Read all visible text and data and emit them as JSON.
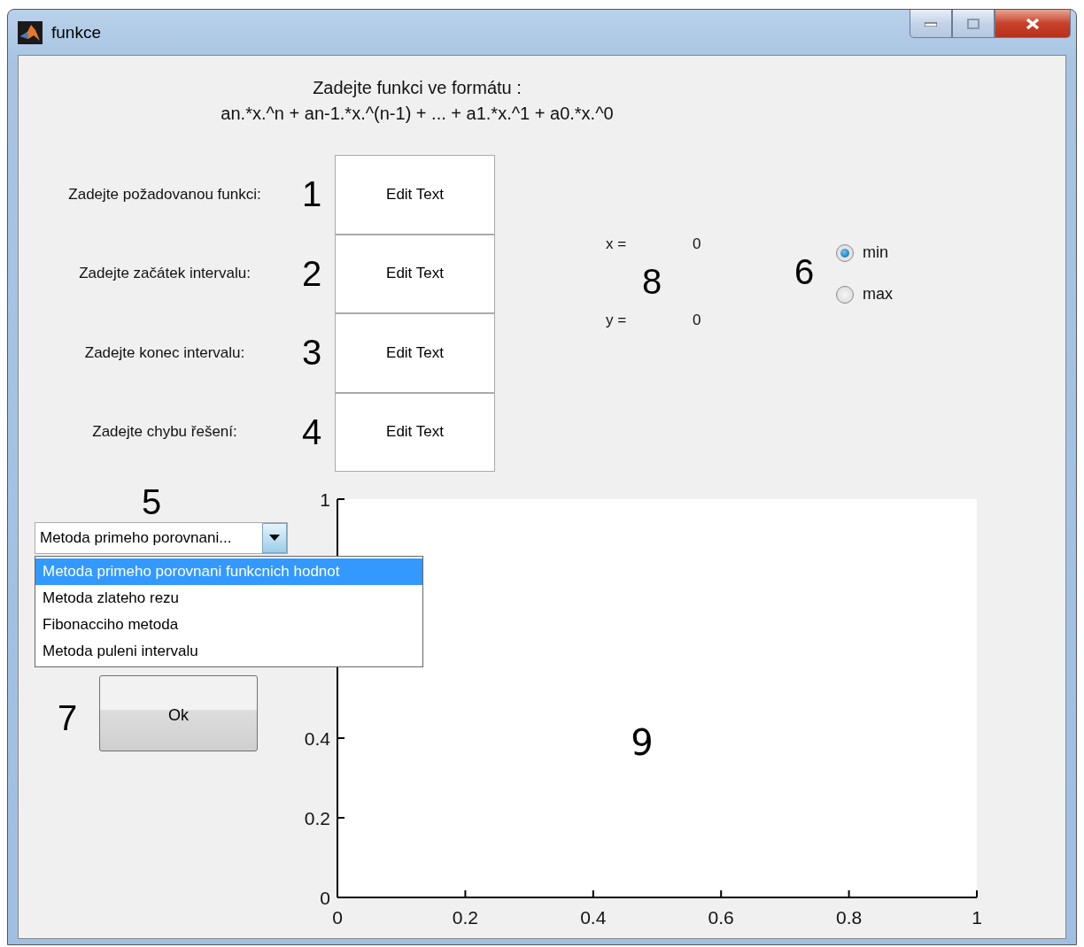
{
  "window": {
    "title": "funkce"
  },
  "heading": [
    "Zadejte funkci ve formátu :",
    "an.*x.^n + an-1.*x.^(n-1) + ... + a1.*x.^1 + a0.*x.^0"
  ],
  "inputs": [
    {
      "label": "Zadejte požadovanou funkci:",
      "number": "1",
      "value": "Edit Text"
    },
    {
      "label": "Zadejte začátek intervalu:",
      "number": "2",
      "value": "Edit Text"
    },
    {
      "label": "Zadejte konec intervalu:",
      "number": "3",
      "value": "Edit Text"
    },
    {
      "label": "Zadejte chybu řešení:",
      "number": "4",
      "value": "Edit Text"
    }
  ],
  "result": {
    "number": "8",
    "rows": [
      {
        "label": "x =",
        "value": "0"
      },
      {
        "label": "y =",
        "value": "0"
      }
    ]
  },
  "extremum": {
    "number": "6",
    "options": [
      {
        "label": "min",
        "selected": true
      },
      {
        "label": "max",
        "selected": false
      }
    ]
  },
  "method": {
    "number": "5",
    "value": "Metoda primeho porovnani...",
    "expanded": true,
    "options": [
      {
        "label": "Metoda primeho porovnani funkcnich hodnot",
        "selected": true
      },
      {
        "label": "Metoda zlateho rezu",
        "selected": false
      },
      {
        "label": "Fibonacciho metoda",
        "selected": false
      },
      {
        "label": "Metoda puleni intervalu",
        "selected": false
      }
    ]
  },
  "ok": {
    "number": "7",
    "label": "Ok"
  },
  "plot": {
    "number": "9",
    "chart_data": {
      "type": "line",
      "xlim": [
        0,
        1
      ],
      "ylim": [
        0,
        1
      ],
      "xticks": [
        0,
        0.2,
        0.4,
        0.6,
        0.8,
        1
      ],
      "yticks": [
        0,
        0.2,
        0.4,
        1
      ]
    }
  }
}
